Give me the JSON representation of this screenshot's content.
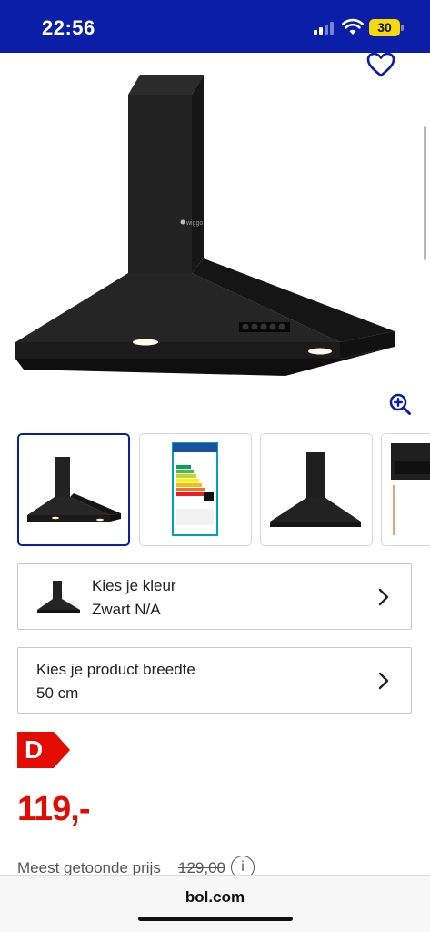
{
  "status_bar": {
    "time": "22:56",
    "battery": "30"
  },
  "product": {
    "brand_logo_text": "wiggo",
    "thumbnail_count": 4
  },
  "options": [
    {
      "label": "Kies je kleur",
      "value": "Zwart N/A"
    },
    {
      "label": "Kies je product breedte",
      "value": "50 cm"
    }
  ],
  "energy_label": {
    "class": "D",
    "color": "#e40b00"
  },
  "price": {
    "current": "119,-",
    "reference_label": "Meest getoonde prijs",
    "reference_value": "129,00",
    "info_icon": "i",
    "color": "#e40b00"
  },
  "browser": {
    "url": "bol.com"
  },
  "colors": {
    "brand_blue": "#0a1ea8",
    "price_red": "#e40b00"
  },
  "icons": [
    "heart-icon",
    "zoom-in-icon",
    "chevron-right-icon",
    "info-icon",
    "signal-icon",
    "wifi-icon",
    "battery-icon"
  ]
}
